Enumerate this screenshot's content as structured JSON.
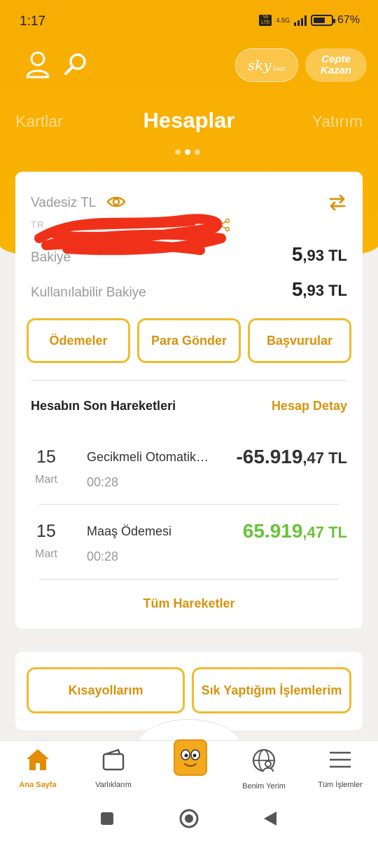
{
  "status_bar": {
    "time": "1:17",
    "volte": "Vo LTE",
    "network": "4.5G",
    "battery_percent": "67%",
    "battery_level": 0.67
  },
  "header": {
    "profile_icon": "user-icon",
    "search_icon": "search-icon",
    "sky_label": "sky",
    "sky_sub": "limit",
    "cepte_kazan_label": "Cepte Kazan"
  },
  "tabs": {
    "left": "Kartlar",
    "active": "Hesaplar",
    "right": "Yatırım",
    "page_count": 3,
    "active_page": 2
  },
  "account": {
    "type": "Vadesiz TL",
    "iban_partial": "TR",
    "balance_label": "Bakiye",
    "balance_int": "5",
    "balance_dec": ",93 TL",
    "available_label": "Kullanılabilir Bakiye",
    "available_int": "5",
    "available_dec": ",93 TL"
  },
  "actions": {
    "payments": "Ödemeler",
    "send_money": "Para Gönder",
    "applications": "Başvurular"
  },
  "recent": {
    "title": "Hesabın Son Hareketleri",
    "detail_link": "Hesap Detay",
    "transactions": [
      {
        "day": "15",
        "month": "Mart",
        "desc": "Gecikmeli Otomatik Ödeme",
        "time": "00:28",
        "amount_int": "-65.919",
        "amount_dec": ",47 TL",
        "type": "debit"
      },
      {
        "day": "15",
        "month": "Mart",
        "desc": "Maaş Ödemesi",
        "time": "00:28",
        "amount_int": "65.919",
        "amount_dec": ",47 TL",
        "type": "credit"
      }
    ],
    "all_link": "Tüm Hareketler"
  },
  "shortcuts": {
    "my_shortcuts": "Kısayollarım",
    "frequent": "Sık Yaptığım İşlemlerim"
  },
  "bottom_nav": {
    "home": "Ana Sayfa",
    "assets": "Varlıklarım",
    "my_place": "Benim Yerim",
    "all_ops": "Tüm İşlemler"
  },
  "colors": {
    "brand": "#f9b404",
    "accent": "#d8930d",
    "credit": "#6ac23a"
  }
}
